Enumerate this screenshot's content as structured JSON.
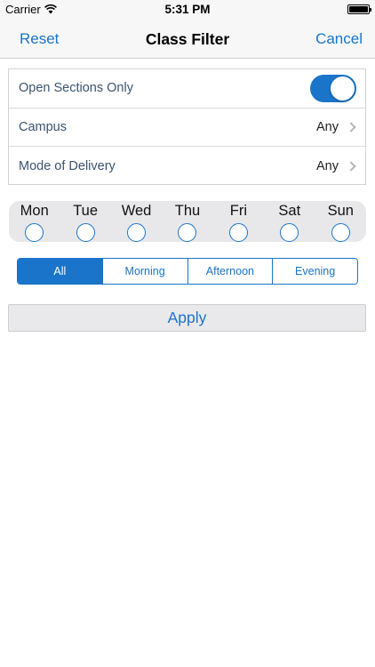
{
  "status_bar": {
    "carrier": "Carrier",
    "time": "5:31 PM"
  },
  "nav": {
    "left_button": "Reset",
    "title": "Class Filter",
    "right_button": "Cancel"
  },
  "settings": {
    "open_sections": {
      "label": "Open Sections Only",
      "enabled": true
    },
    "campus": {
      "label": "Campus",
      "value": "Any"
    },
    "mode_of_delivery": {
      "label": "Mode of Delivery",
      "value": "Any"
    }
  },
  "days": [
    "Mon",
    "Tue",
    "Wed",
    "Thu",
    "Fri",
    "Sat",
    "Sun"
  ],
  "time_of_day": {
    "options": [
      "All",
      "Morning",
      "Afternoon",
      "Evening"
    ],
    "selected": "All"
  },
  "apply_label": "Apply",
  "colors": {
    "accent": "#1a74c9",
    "bar_background": "#f7f7f8",
    "days_background": "#e8e8ea"
  }
}
